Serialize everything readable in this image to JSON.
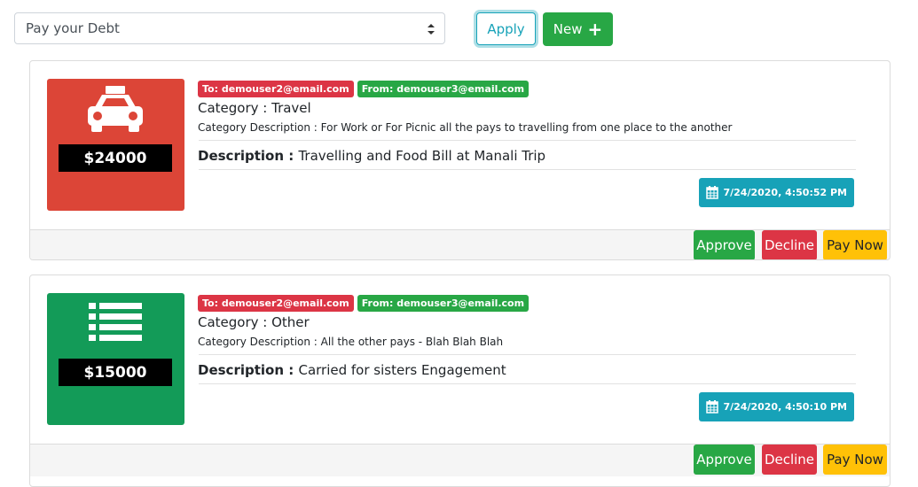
{
  "filter": {
    "selected": "Pay your Debt"
  },
  "toolbar": {
    "apply_label": "Apply",
    "new_label": "New"
  },
  "colors": {
    "travel_tile": "#dc4537",
    "other_tile": "#139b58",
    "info": "#17a2b8",
    "success": "#28a745",
    "danger": "#dc3545",
    "warning": "#ffc107"
  },
  "debts": [
    {
      "icon": "taxi-icon",
      "amount": "$24000",
      "to": "To: demouser2@email.com",
      "from": "From: demouser3@email.com",
      "category_label": "Category : ",
      "category": "Travel",
      "category_description": "Category Description : For Work or For Picnic all the pays to travelling from one place to the another",
      "description_label": "Description : ",
      "description": "Travelling and Food Bill at Manali Trip",
      "datetime": "7/24/2020, 4:50:52 PM",
      "actions": {
        "approve": "Approve",
        "decline": "Decline",
        "pay": "Pay Now"
      }
    },
    {
      "icon": "list-icon",
      "amount": "$15000",
      "to": "To: demouser2@email.com",
      "from": "From: demouser3@email.com",
      "category_label": "Category : ",
      "category": "Other",
      "category_description": "Category Description : All the other pays - Blah Blah Blah",
      "description_label": "Description : ",
      "description": "Carried for sisters Engagement",
      "datetime": "7/24/2020, 4:50:10 PM",
      "actions": {
        "approve": "Approve",
        "decline": "Decline",
        "pay": "Pay Now"
      }
    }
  ]
}
